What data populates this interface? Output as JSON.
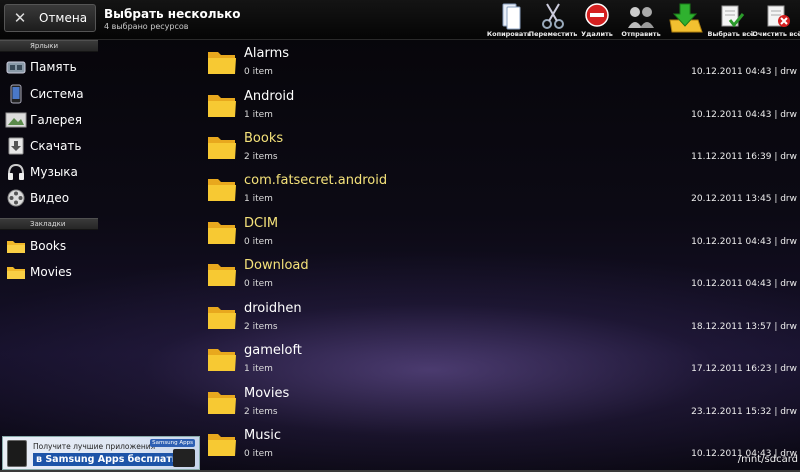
{
  "action_bar": {
    "cancel_label": "Отмена",
    "title": "Выбрать несколько",
    "subtitle": "4 выбрано ресурсов",
    "actions": [
      {
        "label": "Копировать",
        "icon": "copy-icon"
      },
      {
        "label": "Переместить",
        "icon": "scissors-icon"
      },
      {
        "label": "Удалить",
        "icon": "delete-icon"
      },
      {
        "label": "Отправить",
        "icon": "send-icon"
      },
      {
        "label": "",
        "icon": "download-folder-icon"
      },
      {
        "label": "Выбрать всё",
        "icon": "select-all-icon"
      },
      {
        "label": "Очистить всё",
        "icon": "clear-all-icon"
      }
    ]
  },
  "sidebar": {
    "shortcuts_header": "Ярлыки",
    "shortcuts": [
      {
        "label": "Память",
        "icon": "memory-card-icon"
      },
      {
        "label": "Система",
        "icon": "phone-icon"
      },
      {
        "label": "Галерея",
        "icon": "gallery-icon"
      },
      {
        "label": "Скачать",
        "icon": "download-icon"
      },
      {
        "label": "Музыка",
        "icon": "headphones-icon"
      },
      {
        "label": "Видео",
        "icon": "film-reel-icon"
      }
    ],
    "bookmarks_header": "Закладки",
    "bookmarks": [
      {
        "label": "Books",
        "icon": "folder-icon"
      },
      {
        "label": "Movies",
        "icon": "folder-icon"
      }
    ]
  },
  "files": [
    {
      "name": "Alarms",
      "count": "0 item",
      "date": "10.12.2011 04:43 | drw",
      "selected": false
    },
    {
      "name": "Android",
      "count": "1 item",
      "date": "10.12.2011 04:43 | drw",
      "selected": false
    },
    {
      "name": "Books",
      "count": "2 items",
      "date": "11.12.2011 16:39 | drw",
      "selected": true
    },
    {
      "name": "com.fatsecret.android",
      "count": "1 item",
      "date": "20.12.2011 13:45 | drw",
      "selected": true
    },
    {
      "name": "DCIM",
      "count": "0 item",
      "date": "10.12.2011 04:43 | drw",
      "selected": true
    },
    {
      "name": "Download",
      "count": "0 item",
      "date": "10.12.2011 04:43 | drw",
      "selected": true
    },
    {
      "name": "droidhen",
      "count": "2 items",
      "date": "18.12.2011 13:57 | drw",
      "selected": false
    },
    {
      "name": "gameloft",
      "count": "1 item",
      "date": "17.12.2011 16:23 | drw",
      "selected": false
    },
    {
      "name": "Movies",
      "count": "2 items",
      "date": "23.12.2011 15:32 | drw",
      "selected": false
    },
    {
      "name": "Music",
      "count": "0 item",
      "date": "10.12.2011 04:43 | drw",
      "selected": false
    }
  ],
  "ad": {
    "line1": "Получите лучшие приложения",
    "line2": "в Samsung Apps бесплатно",
    "brand": "Samsung Apps"
  },
  "path": "/mnt/sdcard",
  "colors": {
    "selected_text": "#f5e27a",
    "folder": "#f7c933"
  }
}
